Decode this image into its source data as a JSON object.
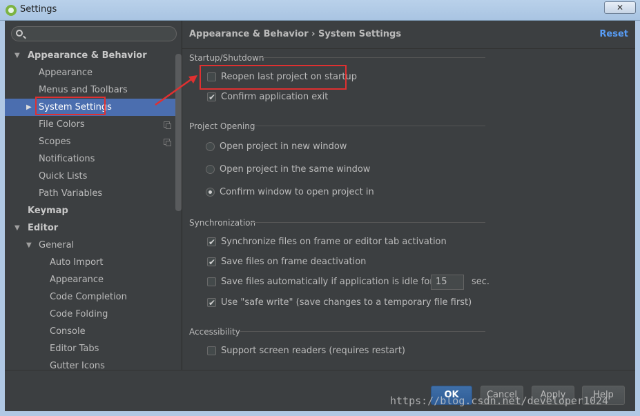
{
  "window": {
    "title": "Settings",
    "close_label": "✕"
  },
  "search": {
    "placeholder": ""
  },
  "sidebar": {
    "items": [
      {
        "label": "Appearance & Behavior",
        "arrow": "▼"
      },
      {
        "label": "Appearance"
      },
      {
        "label": "Menus and Toolbars"
      },
      {
        "label": "System Settings",
        "arrow": "▶"
      },
      {
        "label": "File Colors"
      },
      {
        "label": "Scopes"
      },
      {
        "label": "Notifications"
      },
      {
        "label": "Quick Lists"
      },
      {
        "label": "Path Variables"
      },
      {
        "label": "Keymap"
      },
      {
        "label": "Editor",
        "arrow": "▼"
      },
      {
        "label": "General",
        "arrow": "▼"
      },
      {
        "label": "Auto Import"
      },
      {
        "label": "Appearance"
      },
      {
        "label": "Code Completion"
      },
      {
        "label": "Code Folding"
      },
      {
        "label": "Console"
      },
      {
        "label": "Editor Tabs"
      },
      {
        "label": "Gutter Icons"
      }
    ]
  },
  "content": {
    "breadcrumb": "Appearance & Behavior › System Settings",
    "reset_label": "Reset",
    "startup": {
      "title": "Startup/Shutdown",
      "reopen_label": "Reopen last project on startup",
      "reopen_checked": false,
      "confirm_exit_label": "Confirm application exit",
      "confirm_exit_checked": true
    },
    "project_opening": {
      "title": "Project Opening",
      "options": [
        {
          "label": "Open project in new window",
          "selected": false
        },
        {
          "label": "Open project in the same window",
          "selected": false
        },
        {
          "label": "Confirm window to open project in",
          "selected": true
        }
      ]
    },
    "sync": {
      "title": "Synchronization",
      "sync_files_label": "Synchronize files on frame or editor tab activation",
      "sync_files_checked": true,
      "save_deactivation_label": "Save files on frame deactivation",
      "save_deactivation_checked": true,
      "save_idle_label": "Save files automatically if application is idle for",
      "save_idle_checked": false,
      "idle_value": "15",
      "idle_unit": "sec.",
      "safe_write_label": "Use \"safe write\" (save changes to a temporary file first)",
      "safe_write_checked": true
    },
    "accessibility": {
      "title": "Accessibility",
      "screen_readers_label": "Support screen readers (requires restart)",
      "screen_readers_checked": false
    }
  },
  "footer": {
    "ok_label": "OK",
    "cancel_label": "Cancel",
    "apply_label": "Apply",
    "help_label": "Help"
  },
  "watermark": "https://blog.csdn.net/developer1024",
  "colors": {
    "selection": "#4b6eaf",
    "annotation": "#e03030",
    "link": "#589df6"
  }
}
